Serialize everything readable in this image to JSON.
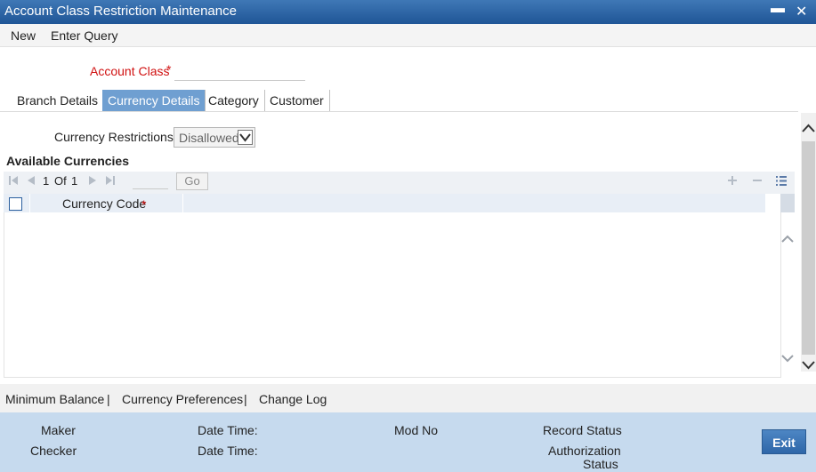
{
  "window": {
    "title": "Account Class Restriction Maintenance",
    "minimize_glyph": "▬",
    "close_glyph": "✕"
  },
  "menu": {
    "new": "New",
    "enter_query": "Enter Query"
  },
  "form": {
    "account_class_label": "Account Class",
    "required_mark": "*",
    "account_class_value": ""
  },
  "tabs": [
    {
      "label": "Branch Details",
      "active": false
    },
    {
      "label": "Currency Details",
      "active": true
    },
    {
      "label": "Category",
      "active": false
    },
    {
      "label": "Customer",
      "active": false
    }
  ],
  "currency": {
    "restrictions_label": "Currency Restrictions",
    "restrictions_value": "Disallowed",
    "section_title": "Available Currencies"
  },
  "grid": {
    "page_current": "1",
    "page_of": "Of",
    "page_total": "1",
    "go_label": "Go",
    "column_header": "Currency Code",
    "required_mark": "*",
    "rows": []
  },
  "footer_links": {
    "minimum_balance": "Minimum Balance",
    "currency_preferences": "Currency Preferences",
    "change_log": "Change Log",
    "separator": "|"
  },
  "audit": {
    "maker": "Maker",
    "checker": "Checker",
    "date_time": "Date Time:",
    "mod_no": "Mod No",
    "record_status": "Record Status",
    "authorization": "Authorization",
    "status": "Status",
    "exit_label": "Exit"
  },
  "colors": {
    "title_bar": "#1f5596",
    "active_tab": "#6f9fd1",
    "required": "#d01010",
    "audit_panel": "#c6daee"
  }
}
